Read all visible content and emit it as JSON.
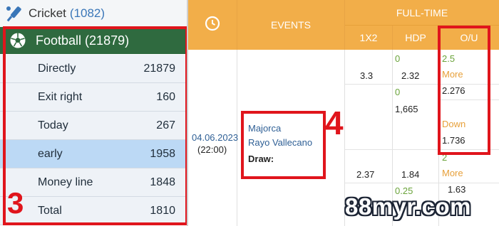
{
  "sidebar": {
    "cricket": {
      "label": "Cricket",
      "count": "(1082)",
      "icon": "cricket-bat-icon"
    },
    "football": {
      "label": "Football",
      "count": "(21879)",
      "icon": "soccer-ball-icon"
    },
    "items": [
      {
        "label": "Directly",
        "count": "21879"
      },
      {
        "label": "Exit right",
        "count": "160"
      },
      {
        "label": "Today",
        "count": "267"
      },
      {
        "label": "early",
        "count": "1958",
        "selected": true
      },
      {
        "label": "Money line",
        "count": "1848"
      },
      {
        "label": "Total",
        "count": "1810"
      }
    ]
  },
  "header": {
    "clock_icon": "clock-icon",
    "events": "EVENTS",
    "full_time": "FULL-TIME",
    "col_1x2": "1X2",
    "col_hdp": "HDP",
    "col_ou": "O/U"
  },
  "match": {
    "date": "04.06.2023",
    "time": "(22:00)",
    "home": "Majorca",
    "away": "Rayo Vallecano",
    "draw_label": "Draw:",
    "odds_1x2_home": "3.3",
    "odds_1x2_away": "2.37",
    "hdp_line_1": "0",
    "hdp_odds_1": "2.32",
    "hdp_line_2": "0",
    "hdp_odds_2": "1,665",
    "hdp_odds_3": "1.84",
    "hdp_line_3": "0.25",
    "ou_line_1": "2.5",
    "ou_more_1": "More",
    "ou_odds_1": "2.276",
    "ou_down_1": "Down",
    "ou_odds_2": "1.736",
    "ou_line_2": "2",
    "ou_more_2": "More",
    "ou_odds_3": "1.63"
  },
  "annotations": {
    "label_3": "3",
    "label_4": "4"
  },
  "watermark": "88myr.com",
  "colors": {
    "header": "#f2ae49",
    "football_active": "#2f6a3f",
    "highlight_red": "#e0151c",
    "selected_row": "#bcd9f5"
  }
}
